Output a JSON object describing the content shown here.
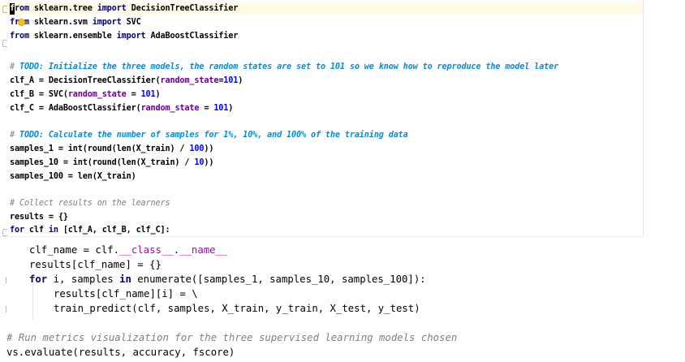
{
  "editor": {
    "top_pane": {
      "lines": [
        [
          "from",
          " sklearn.tree ",
          "import",
          " DecisionTreeClassifier"
        ],
        [
          "from",
          " sklearn.svm ",
          "import",
          " SVC"
        ],
        [
          "from",
          " sklearn.ensemble ",
          "import",
          " AdaBoostClassifier"
        ],
        [
          "# ",
          "TODO: Initialize the three models, the random states are set to 101 so we know how to reproduce the model later"
        ],
        [
          "clf_A = DecisionTreeClassifier(",
          "random_state",
          "=",
          "101",
          ")"
        ],
        [
          "clf_B = SVC(",
          "random_state ",
          "= ",
          "101",
          ")"
        ],
        [
          "clf_C = AdaBoostClassifier(",
          "random_state ",
          "= ",
          "101",
          ")"
        ],
        [
          "# ",
          "TODO: Calculate the number of samples for 1%, 10%, and 100% of the training data"
        ],
        [
          "samples_1 = int(round(len(X_train) / ",
          "100",
          "))"
        ],
        [
          "samples_10 = int(round(len(X_train) / ",
          "10",
          "))"
        ],
        [
          "samples_100 = len(X_train)"
        ],
        [
          "# Collect results on the learners"
        ],
        [
          "results = {}"
        ],
        [
          "for",
          " clf ",
          "in",
          " [clf_A, clf_B, clf_C]:"
        ]
      ]
    },
    "bottom_pane": {
      "lines": [
        [
          "clf_name = clf.",
          "__class__",
          ".",
          "__name__"
        ],
        [
          "results[clf_name] = {}"
        ],
        [
          "for",
          " i, samples ",
          "in",
          " enumerate([samples_1, samples_10, samples_100]):"
        ],
        [
          "results[clf_name][i] = \\"
        ],
        [
          "train_predict(clf, samples, X_train, y_train, X_test, y_test)"
        ],
        [
          "# Run metrics visualization for the three supervised learning models chosen"
        ],
        [
          "vs.evaluate(results, accuracy, fscore)"
        ]
      ]
    },
    "icons": {
      "intention": "lightbulb-icon",
      "fold": "fold-marker-icon"
    },
    "colors": {
      "keyword": "#000080",
      "number": "#0000ff",
      "named_arg": "#660099",
      "comment": "#808080",
      "todo": "#008dde",
      "dunder": "#b200b2",
      "current_line": "#fffbe5"
    }
  }
}
